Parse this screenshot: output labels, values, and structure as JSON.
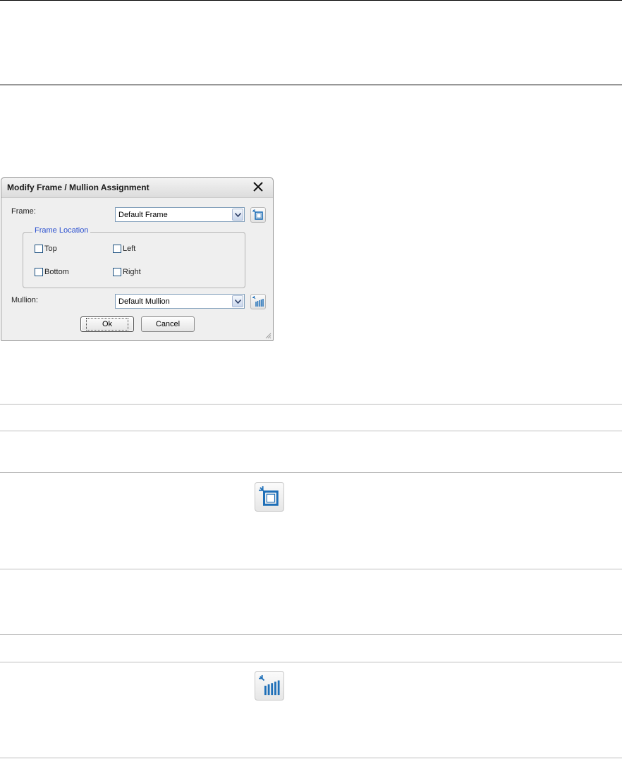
{
  "dialog": {
    "title": "Modify Frame / Mullion Assignment",
    "frame_label": "Frame:",
    "frame_value": "Default Frame",
    "frame_location_legend": "Frame Location",
    "checkboxes": {
      "top": "Top",
      "left": "Left",
      "bottom": "Bottom",
      "right": "Right"
    },
    "mullion_label": "Mullion:",
    "mullion_value": "Default Mullion",
    "ok_label": "Ok",
    "cancel_label": "Cancel"
  },
  "icons": {
    "frame_style_icon": "frame-select-icon",
    "mullion_style_icon": "mullion-select-icon",
    "close_icon": "close-icon"
  },
  "colors": {
    "legend_text": "#2a4fcf",
    "dialog_bg": "#efefef",
    "icon_blue": "#1e6fb8"
  }
}
